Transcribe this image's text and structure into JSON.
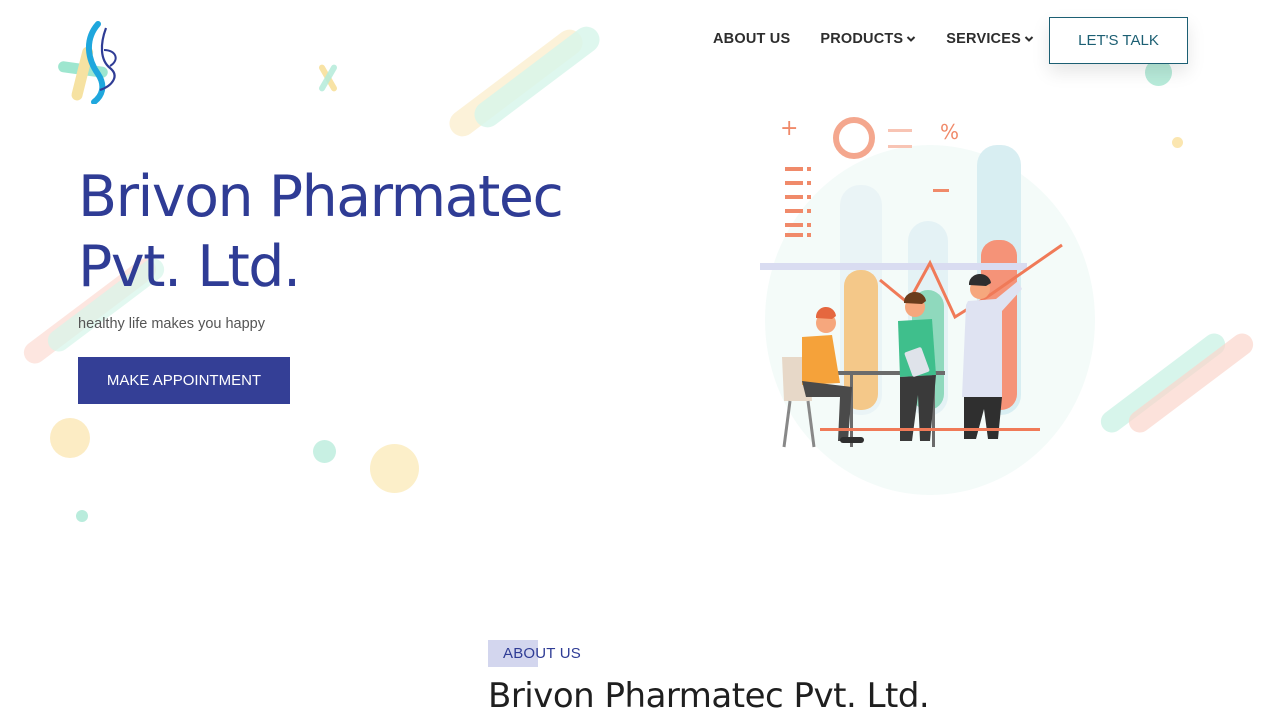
{
  "header": {
    "logo_icon": "brivon-logo-icon",
    "nav": {
      "about": "ABOUT US",
      "products": "PRODUCTS",
      "services": "SERVICES"
    },
    "cta": "LET'S TALK"
  },
  "hero": {
    "title_line1": "Brivon Pharmatec",
    "title_line2": "Pvt. Ltd.",
    "subtitle": "healthy life makes you happy",
    "button": "MAKE APPOINTMENT",
    "illustration": "lab-scientists-illustration"
  },
  "about": {
    "tag": "ABOUT US",
    "heading": "Brivon Pharmatec Pvt. Ltd."
  },
  "colors": {
    "primary": "#343f96",
    "title": "#2f3c95",
    "teal": "#1c5f73",
    "mint": "#a8e8d4",
    "peach": "#fbd3c8",
    "cream": "#fbe9b7"
  }
}
